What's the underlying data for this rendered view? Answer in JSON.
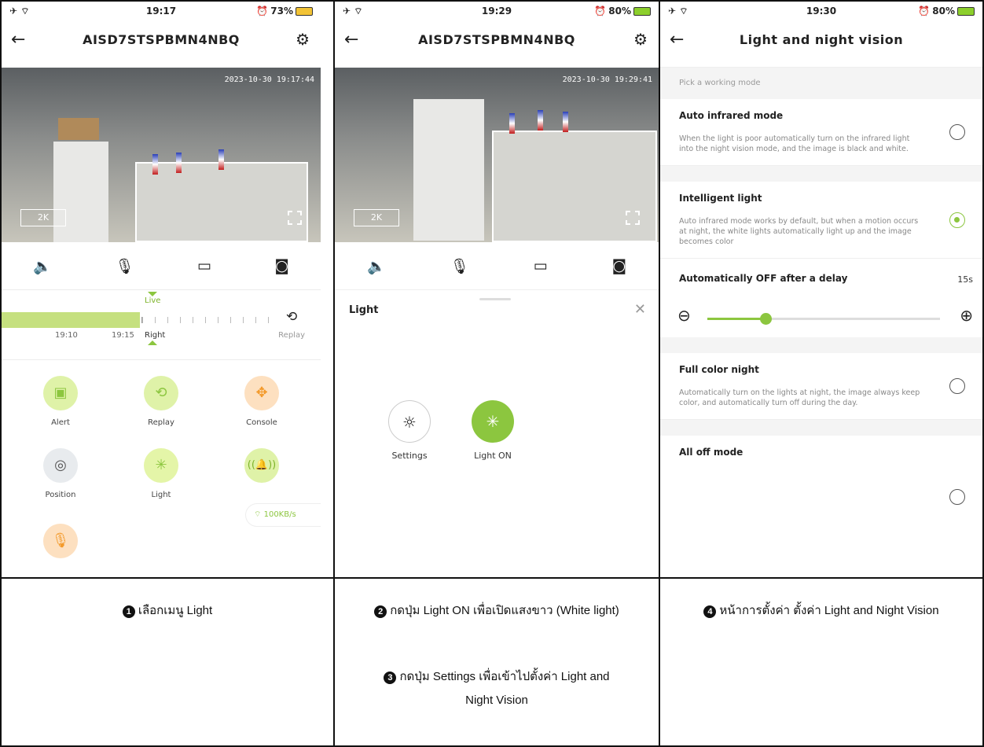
{
  "panel1": {
    "status": {
      "time": "19:17",
      "battery": "73%"
    },
    "title": "AISD7STSPBMN4NBQ",
    "video": {
      "timestamp": "2023-10-30 19:17:44",
      "quality": "2K"
    },
    "timeline": {
      "live": "Live",
      "t1": "19:10",
      "t2": "19:15",
      "right": "Right",
      "replay": "Replay"
    },
    "menu": [
      {
        "label": "Alert"
      },
      {
        "label": "Replay"
      },
      {
        "label": "Console"
      },
      {
        "label": "Position"
      },
      {
        "label": "Light"
      }
    ],
    "speed": "100KB/s"
  },
  "panel2": {
    "status": {
      "time": "19:29",
      "battery": "80%"
    },
    "title": "AISD7STSPBMN4NBQ",
    "video": {
      "timestamp": "2023-10-30 19:29:41",
      "quality": "2K"
    },
    "sheet": {
      "title": "Light",
      "settings": "Settings",
      "light_on": "Light ON"
    }
  },
  "panel3": {
    "status": {
      "time": "19:30",
      "battery": "80%"
    },
    "title": "Light and night vision",
    "hint": "Pick a working mode",
    "auto_ir": {
      "title": "Auto infrared mode",
      "desc": "When the light is poor automatically turn on the infrared light into the night vision mode, and the image is black and white."
    },
    "intelligent": {
      "title": "Intelligent light",
      "desc": "Auto infrared mode works by default, but when a motion occurs at night, the white lights automatically light up and the image becomes color"
    },
    "delay": {
      "label": "Automatically OFF after a delay",
      "value": "15s",
      "level": 0.25
    },
    "full_color": {
      "title": "Full color night",
      "desc": "Automatically turn on the lights at night, the image always keep color, and automatically turn off during the day."
    },
    "all_off": {
      "title": "All off mode"
    }
  },
  "captions": {
    "c1": "เลือกเมนู Light",
    "c2": "กดปุ่ม Light ON  เพื่อเปิดแสงขาว (White light)",
    "c3a": "กดปุ่ม Settings เพื่อเข้าไปตั้งค่า Light and",
    "c3b": "Night Vision",
    "c4": "หน้าการตั้งค่า ตั้งค่า Light and Night Vision"
  },
  "colors": {
    "accent": "#8cc63f",
    "alert_bg": "#dff2a8",
    "console_bg": "#fde0c0"
  }
}
